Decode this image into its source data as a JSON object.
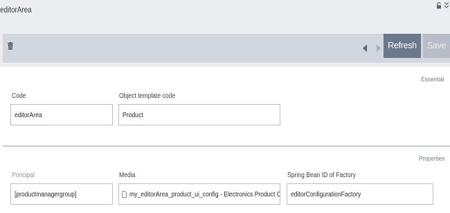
{
  "window": {
    "title": "editorArea",
    "icons": {
      "lock": "lock-icon",
      "collapse": "chevrons-down-icon"
    }
  },
  "toolbar": {
    "delete_icon": "trash-icon",
    "prev_icon": "chevron-left-icon",
    "next_icon": "chevron-right-icon",
    "refresh_label": "Refresh",
    "save_label": "Save"
  },
  "sections": {
    "essential": {
      "title": "Essential",
      "fields": {
        "code": {
          "label": "Code",
          "value": "editorArea"
        },
        "object_template_code": {
          "label": "Object template code",
          "value": "Product"
        }
      }
    },
    "properties": {
      "title": "Properties",
      "fields": {
        "principal": {
          "label": "Principal",
          "value": "[productmanagergroup]"
        },
        "media": {
          "label": "Media",
          "value": "my_editorArea_product_ui_config - Electronics Product Catalog",
          "icon": "document-icon"
        },
        "spring_bean": {
          "label": "Spring Bean ID of Factory",
          "value": "editorConfigurationFactory"
        }
      }
    }
  },
  "colors": {
    "header_bg": "#ebedf1",
    "toolbar_strip": "#d2d7df",
    "refresh_button": "#6b778b",
    "save_button_disabled": "#b6bdc8"
  }
}
